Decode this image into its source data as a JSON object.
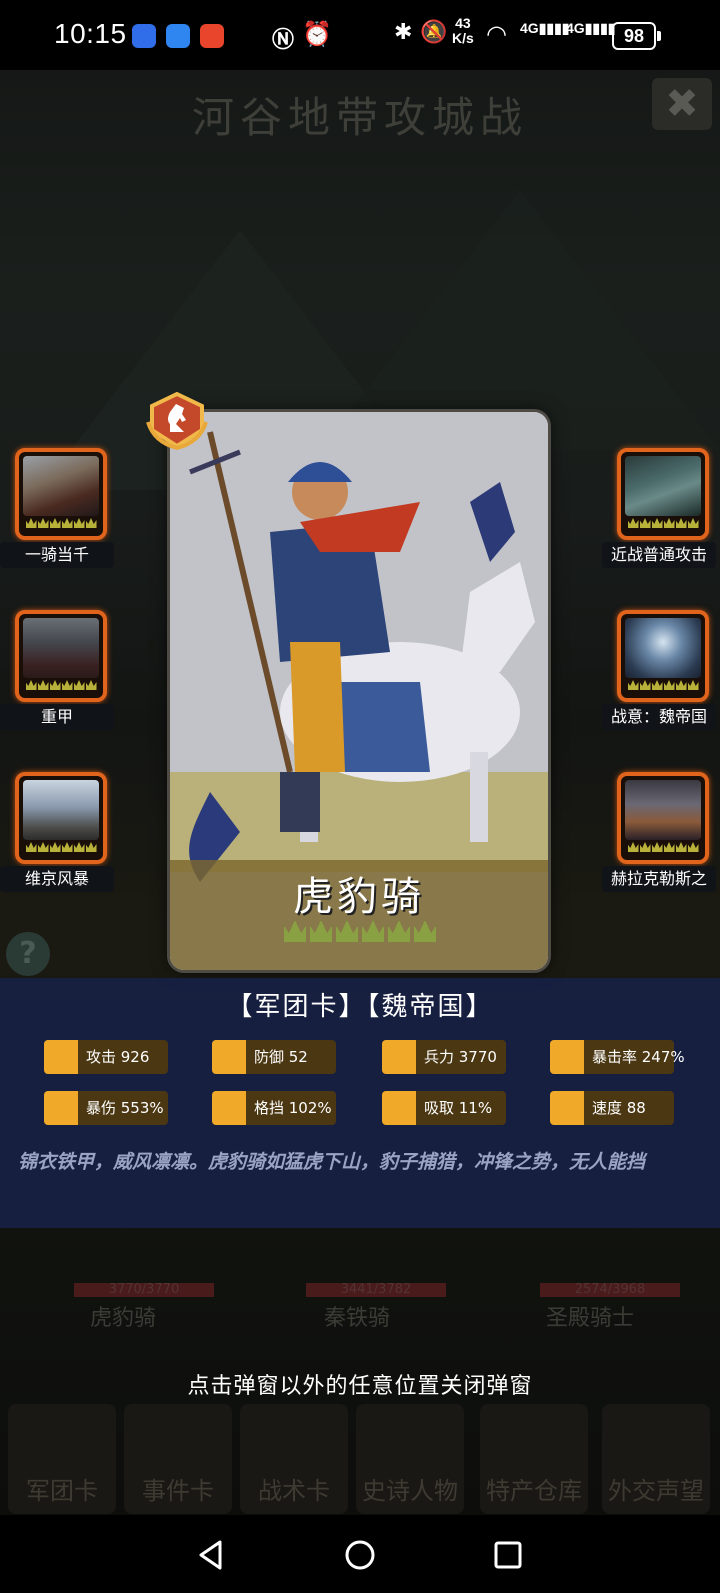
{
  "status_bar": {
    "time": "10:15",
    "net_speed_top": "43",
    "net_speed_unit": "K/s",
    "signal1": "4G",
    "signal2": "4G",
    "battery": "98"
  },
  "background": {
    "title": "河谷地带攻城战",
    "close_icon": "✖",
    "help_icon": "?",
    "units": [
      {
        "hp": "3770/3770",
        "name": "虎豹骑"
      },
      {
        "hp": "3441/3782",
        "name": "秦铁骑"
      },
      {
        "hp": "2574/3968",
        "name": "圣殿骑士"
      }
    ],
    "tabs": [
      "军团卡",
      "事件卡",
      "战术卡",
      "史诗人物",
      "特产仓库",
      "外交声望"
    ]
  },
  "skills_left": [
    {
      "name": "一骑当千",
      "icon": "cavalry-rider-icon"
    },
    {
      "name": "重甲",
      "icon": "armored-knight-icon"
    },
    {
      "name": "维京风暴",
      "icon": "viking-warriors-icon"
    }
  ],
  "skills_right": [
    {
      "name": "近战普通攻击",
      "icon": "sword-knight-icon"
    },
    {
      "name": "战意：魏帝国",
      "icon": "sword-in-stone-icon"
    },
    {
      "name": "赫拉克勒斯之",
      "icon": "hercules-warrior-icon"
    }
  ],
  "card": {
    "name": "虎豹骑",
    "stars": 6,
    "badge_icon": "knight-chess-badge-icon",
    "image": "mounted-cavalry-spear-icon"
  },
  "info": {
    "tags": "【军团卡】【魏帝国】",
    "stats": [
      {
        "label": "攻击 926",
        "icon": "sword-icon"
      },
      {
        "label": "防御 52",
        "icon": "shield-icon"
      },
      {
        "label": "兵力 3770",
        "icon": "heart-icon"
      },
      {
        "label": "暴击率 247%",
        "icon": "crosshair-icon"
      },
      {
        "label": "暴伤 553%",
        "icon": "burst-icon"
      },
      {
        "label": "格挡 102%",
        "icon": "parry-icon"
      },
      {
        "label": "吸取 11%",
        "icon": "drain-icon"
      },
      {
        "label": "速度 88",
        "icon": "boot-icon"
      }
    ],
    "description": "锦衣铁甲，威风凛凛。虎豹骑如猛虎下山，豹子捕猎，冲锋之势，无人能挡"
  },
  "hint": "点击弹窗以外的任意位置关闭弹窗",
  "colors": {
    "frame_orange": "#e0641c",
    "panel_navy": "#182144",
    "stat_gold": "#f0a928",
    "stat_bg": "#4b3712",
    "card_band": "#7c682e"
  }
}
